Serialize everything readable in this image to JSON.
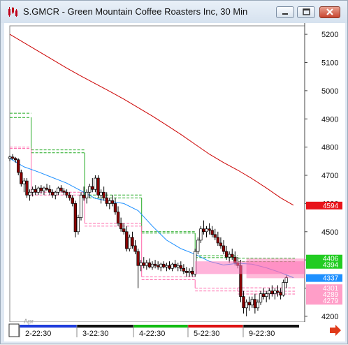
{
  "window": {
    "title": "S.GMCR - Green Mountain Coffee Roasters Inc, 30 Min"
  },
  "colors": {
    "up_candle": "#ffffff",
    "down_candle": "#8b0000",
    "moving_avg_long": "#cc0000",
    "moving_avg_short": "#1e90ff",
    "price_marker": "#e8141b",
    "ma_marker": "#1e90ff",
    "green_level": "#22aa22",
    "pink_level": "#ff66aa"
  },
  "chart_data": {
    "type": "candlestick",
    "title": "",
    "y_axis": {
      "ticks": [
        "5200",
        "5100",
        "5000",
        "4900",
        "4800",
        "4700",
        "4600",
        "4500",
        "4400",
        "4300",
        "4200"
      ],
      "range": [
        4180,
        5230
      ]
    },
    "x_axis": {
      "month_label": "Apr",
      "ticks": [
        "2-22:30",
        "3-22:30",
        "4-22:30",
        "5-22:30",
        "9-22:30"
      ],
      "day_colors": [
        "#1e3cdc",
        "#111111",
        "#11bb11",
        "#dd1111",
        "#111111"
      ]
    },
    "price_labels": [
      {
        "text": "4594",
        "value": 4594,
        "bg": "#e8141b",
        "fg": "#ffffff"
      },
      {
        "text": "4406",
        "value": 4406,
        "bg": "#22cc22",
        "fg": "#ffffff"
      },
      {
        "text": "4394",
        "value": 4394,
        "bg": "#22cc22",
        "fg": "#ffffff"
      },
      {
        "text": "4337",
        "value": 4337,
        "bg": "#1e90ff",
        "fg": "#ffffff"
      },
      {
        "text": "4301",
        "value": 4301,
        "bg": "#ff9ec8",
        "fg": "#ffffff"
      },
      {
        "text": "4289",
        "value": 4289,
        "bg": "#ff9ec8",
        "fg": "#ffffff"
      },
      {
        "text": "4279",
        "value": 4279,
        "bg": "#ff9ec8",
        "fg": "#ffffff"
      }
    ],
    "series": [
      {
        "name": "",
        "kind": "ma_long",
        "x": [
          0,
          20,
          40,
          60,
          80,
          100,
          120,
          140,
          160,
          180,
          200,
          220,
          240,
          260,
          280,
          300,
          320,
          340,
          360,
          380,
          398
        ],
        "y": [
          5200,
          5170,
          5140,
          5110,
          5080,
          5052,
          5025,
          4998,
          4970,
          4940,
          4910,
          4878,
          4845,
          4810,
          4775,
          4745,
          4718,
          4688,
          4655,
          4620,
          4594
        ]
      },
      {
        "name": "",
        "kind": "ma_short",
        "x": [
          0,
          20,
          40,
          60,
          80,
          100,
          120,
          140,
          160,
          180,
          200,
          220,
          240,
          260,
          280,
          300,
          320,
          340,
          360,
          380,
          398
        ],
        "y": [
          4760,
          4730,
          4712,
          4692,
          4672,
          4645,
          4618,
          4608,
          4600,
          4575,
          4520,
          4470,
          4440,
          4420,
          4395,
          4382,
          4388,
          4385,
          4372,
          4355,
          4337
        ]
      }
    ],
    "candles": [
      [
        0,
        4760,
        4770,
        4750,
        4765
      ],
      [
        4,
        4765,
        4775,
        4755,
        4760
      ],
      [
        8,
        4760,
        4765,
        4745,
        4755
      ],
      [
        12,
        4755,
        4760,
        4700,
        4710
      ],
      [
        16,
        4710,
        4720,
        4660,
        4670
      ],
      [
        20,
        4670,
        4690,
        4640,
        4680
      ],
      [
        24,
        4680,
        4690,
        4620,
        4630
      ],
      [
        28,
        4630,
        4650,
        4610,
        4640
      ],
      [
        32,
        4640,
        4660,
        4625,
        4650
      ],
      [
        36,
        4650,
        4665,
        4630,
        4640
      ],
      [
        40,
        4640,
        4660,
        4630,
        4655
      ],
      [
        44,
        4655,
        4665,
        4635,
        4645
      ],
      [
        48,
        4645,
        4660,
        4630,
        4655
      ],
      [
        52,
        4655,
        4670,
        4645,
        4650
      ],
      [
        56,
        4650,
        4665,
        4630,
        4640
      ],
      [
        60,
        4640,
        4650,
        4620,
        4630
      ],
      [
        64,
        4630,
        4645,
        4615,
        4640
      ],
      [
        68,
        4640,
        4660,
        4630,
        4655
      ],
      [
        72,
        4655,
        4665,
        4640,
        4645
      ],
      [
        76,
        4645,
        4655,
        4630,
        4640
      ],
      [
        80,
        4640,
        4650,
        4620,
        4630
      ],
      [
        84,
        4630,
        4640,
        4610,
        4620
      ],
      [
        88,
        4620,
        4630,
        4590,
        4600
      ],
      [
        92,
        4600,
        4610,
        4480,
        4500
      ],
      [
        96,
        4500,
        4560,
        4490,
        4550
      ],
      [
        100,
        4550,
        4640,
        4540,
        4630
      ],
      [
        104,
        4630,
        4660,
        4610,
        4620
      ],
      [
        108,
        4620,
        4650,
        4600,
        4640
      ],
      [
        112,
        4640,
        4670,
        4620,
        4660
      ],
      [
        116,
        4660,
        4690,
        4640,
        4650
      ],
      [
        120,
        4650,
        4700,
        4640,
        4690
      ],
      [
        124,
        4690,
        4700,
        4620,
        4630
      ],
      [
        128,
        4630,
        4650,
        4600,
        4640
      ],
      [
        132,
        4640,
        4660,
        4610,
        4620
      ],
      [
        136,
        4620,
        4640,
        4590,
        4600
      ],
      [
        140,
        4600,
        4620,
        4580,
        4610
      ],
      [
        144,
        4610,
        4630,
        4590,
        4600
      ],
      [
        148,
        4600,
        4620,
        4560,
        4570
      ],
      [
        152,
        4570,
        4590,
        4520,
        4530
      ],
      [
        156,
        4530,
        4550,
        4500,
        4510
      ],
      [
        160,
        4510,
        4530,
        4490,
        4500
      ],
      [
        164,
        4500,
        4520,
        4430,
        4440
      ],
      [
        168,
        4440,
        4490,
        4430,
        4480
      ],
      [
        172,
        4480,
        4500,
        4440,
        4450
      ],
      [
        176,
        4450,
        4470,
        4420,
        4430
      ],
      [
        180,
        4430,
        4440,
        4300,
        4380
      ],
      [
        184,
        4380,
        4400,
        4360,
        4390
      ],
      [
        188,
        4390,
        4410,
        4370,
        4380
      ],
      [
        192,
        4380,
        4400,
        4365,
        4390
      ],
      [
        196,
        4390,
        4405,
        4370,
        4375
      ],
      [
        200,
        4375,
        4395,
        4365,
        4385
      ],
      [
        204,
        4385,
        4400,
        4370,
        4380
      ],
      [
        208,
        4380,
        4395,
        4365,
        4375
      ],
      [
        212,
        4375,
        4390,
        4360,
        4385
      ],
      [
        216,
        4385,
        4395,
        4370,
        4375
      ],
      [
        220,
        4375,
        4390,
        4360,
        4380
      ],
      [
        224,
        4380,
        4395,
        4365,
        4370
      ],
      [
        228,
        4370,
        4390,
        4360,
        4385
      ],
      [
        232,
        4385,
        4400,
        4370,
        4375
      ],
      [
        236,
        4375,
        4390,
        4360,
        4380
      ],
      [
        240,
        4380,
        4395,
        4360,
        4370
      ],
      [
        244,
        4370,
        4385,
        4350,
        4360
      ],
      [
        248,
        4360,
        4375,
        4340,
        4355
      ],
      [
        252,
        4355,
        4370,
        4340,
        4360
      ],
      [
        256,
        4360,
        4375,
        4340,
        4350
      ],
      [
        260,
        4350,
        4440,
        4340,
        4430
      ],
      [
        264,
        4430,
        4480,
        4420,
        4470
      ],
      [
        268,
        4470,
        4520,
        4460,
        4510
      ],
      [
        272,
        4510,
        4540,
        4490,
        4500
      ],
      [
        276,
        4500,
        4520,
        4480,
        4510
      ],
      [
        280,
        4510,
        4530,
        4490,
        4505
      ],
      [
        284,
        4505,
        4520,
        4480,
        4490
      ],
      [
        288,
        4490,
        4510,
        4470,
        4480
      ],
      [
        292,
        4480,
        4500,
        4450,
        4460
      ],
      [
        296,
        4460,
        4480,
        4440,
        4450
      ],
      [
        300,
        4450,
        4470,
        4420,
        4430
      ],
      [
        304,
        4430,
        4450,
        4400,
        4410
      ],
      [
        308,
        4410,
        4430,
        4390,
        4420
      ],
      [
        312,
        4420,
        4440,
        4400,
        4410
      ],
      [
        316,
        4410,
        4430,
        4380,
        4390
      ],
      [
        320,
        4390,
        4410,
        4370,
        4380
      ],
      [
        324,
        4380,
        4400,
        4250,
        4270
      ],
      [
        328,
        4270,
        4290,
        4210,
        4230
      ],
      [
        332,
        4230,
        4260,
        4200,
        4250
      ],
      [
        336,
        4250,
        4270,
        4220,
        4240
      ],
      [
        340,
        4240,
        4270,
        4230,
        4260
      ],
      [
        344,
        4260,
        4280,
        4210,
        4230
      ],
      [
        348,
        4230,
        4260,
        4220,
        4250
      ],
      [
        352,
        4250,
        4290,
        4240,
        4280
      ],
      [
        356,
        4280,
        4300,
        4260,
        4270
      ],
      [
        360,
        4270,
        4290,
        4250,
        4280
      ],
      [
        364,
        4280,
        4300,
        4260,
        4290
      ],
      [
        368,
        4290,
        4310,
        4270,
        4280
      ],
      [
        372,
        4280,
        4300,
        4260,
        4290
      ],
      [
        376,
        4290,
        4310,
        4270,
        4285
      ],
      [
        380,
        4285,
        4300,
        4260,
        4275
      ],
      [
        384,
        4275,
        4330,
        4270,
        4320
      ],
      [
        388,
        4320,
        4345,
        4300,
        4337
      ]
    ],
    "levels": [
      {
        "color": "#22aa22",
        "segments": [
          [
            0,
            30,
            4920
          ],
          [
            0,
            30,
            4905
          ],
          [
            30,
            105,
            4790
          ],
          [
            30,
            105,
            4780
          ],
          [
            105,
            185,
            4630
          ],
          [
            105,
            185,
            4620
          ],
          [
            185,
            260,
            4500
          ],
          [
            185,
            260,
            4495
          ],
          [
            260,
            320,
            4415
          ],
          [
            260,
            320,
            4408
          ],
          [
            320,
            400,
            4406
          ],
          [
            320,
            400,
            4394
          ]
        ]
      },
      {
        "color": "#ff66aa",
        "segments": [
          [
            0,
            30,
            4800
          ],
          [
            0,
            30,
            4795
          ],
          [
            30,
            105,
            4640
          ],
          [
            30,
            105,
            4630
          ],
          [
            105,
            185,
            4530
          ],
          [
            105,
            185,
            4520
          ],
          [
            185,
            260,
            4340
          ],
          [
            185,
            260,
            4330
          ],
          [
            260,
            320,
            4300
          ],
          [
            260,
            320,
            4290
          ],
          [
            320,
            400,
            4301
          ],
          [
            320,
            400,
            4289
          ],
          [
            320,
            400,
            4279
          ]
        ]
      }
    ]
  }
}
